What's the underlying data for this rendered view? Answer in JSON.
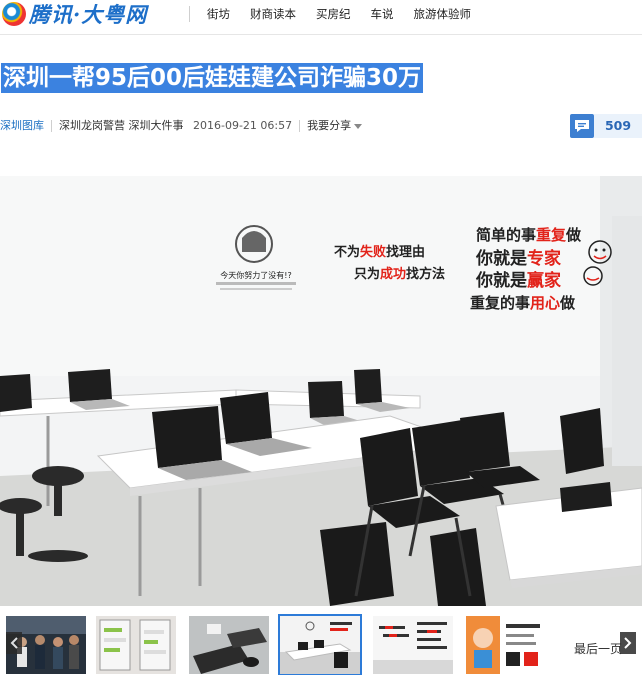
{
  "header": {
    "logo_text": "腾讯·大粤网",
    "nav": [
      "街坊",
      "财商读本",
      "买房纪",
      "车说",
      "旅游体验师"
    ]
  },
  "article": {
    "title": "深圳一帮95后00后娃娃建公司诈骗30万",
    "channel": "深圳图库",
    "source": "深圳龙岗警营",
    "tag": "深圳大件事",
    "datetime": "2016-09-21 06:57",
    "share_label": "我要分享",
    "comment_count": "509"
  },
  "photo": {
    "wall_text": {
      "poster_title": "今天你努力了没有!?",
      "slogan_left_1": "不为",
      "slogan_left_1_red": "失败",
      "slogan_left_1_end": "找理由",
      "slogan_left_2": "只为",
      "slogan_left_2_red": "成功",
      "slogan_left_2_end": "找方法",
      "slogan_right_1a": "简单的事",
      "slogan_right_1b": "重复",
      "slogan_right_1c": "做",
      "slogan_right_2a": "你就是",
      "slogan_right_2b": "专家",
      "slogan_right_3a": "你就是",
      "slogan_right_3b": "赢家",
      "slogan_right_4a": "重复的事",
      "slogan_right_4b": "用心",
      "slogan_right_4c": "做"
    }
  },
  "gallery": {
    "last_page_label": "最后一页",
    "active_index": 3
  },
  "colors": {
    "accent_blue": "#3b82e0",
    "link_blue": "#1a6fc2",
    "slogan_red": "#e2231a"
  }
}
